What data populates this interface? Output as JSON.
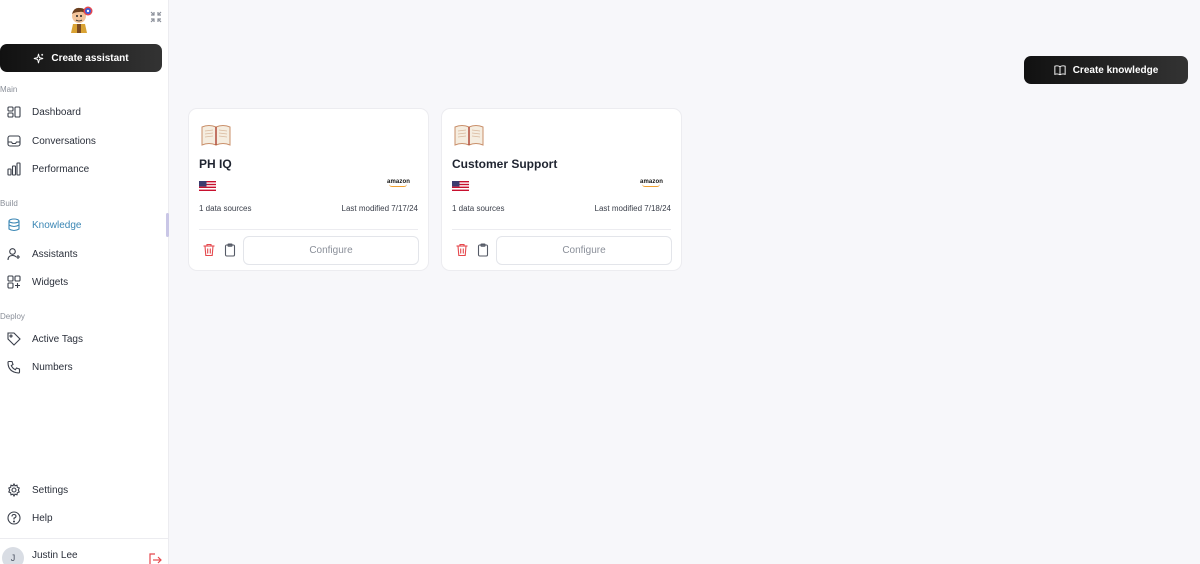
{
  "sidebar": {
    "create_assistant_label": "Create assistant",
    "sections": {
      "main": "Main",
      "build": "Build",
      "deploy": "Deploy"
    },
    "items": {
      "dashboard": "Dashboard",
      "conversations": "Conversations",
      "performance": "Performance",
      "knowledge": "Knowledge",
      "assistants": "Assistants",
      "widgets": "Widgets",
      "active_tags": "Active Tags",
      "numbers": "Numbers",
      "settings": "Settings",
      "help": "Help"
    },
    "active_item": "knowledge",
    "user": {
      "name": "Justin Lee",
      "initial": "J"
    }
  },
  "main": {
    "create_knowledge_label": "Create knowledge",
    "cards": [
      {
        "title": "PH IQ",
        "vendor": "amazon",
        "sources": "1 data sources",
        "modified": "Last modified 7/17/24",
        "configure_label": "Configure"
      },
      {
        "title": "Customer Support",
        "vendor": "amazon",
        "sources": "1 data sources",
        "modified": "Last modified 7/18/24",
        "configure_label": "Configure"
      }
    ]
  },
  "colors": {
    "accent": "#3a86b4",
    "danger": "#e5484d",
    "button_dark": "#111111",
    "background": "#f7f7fa"
  }
}
